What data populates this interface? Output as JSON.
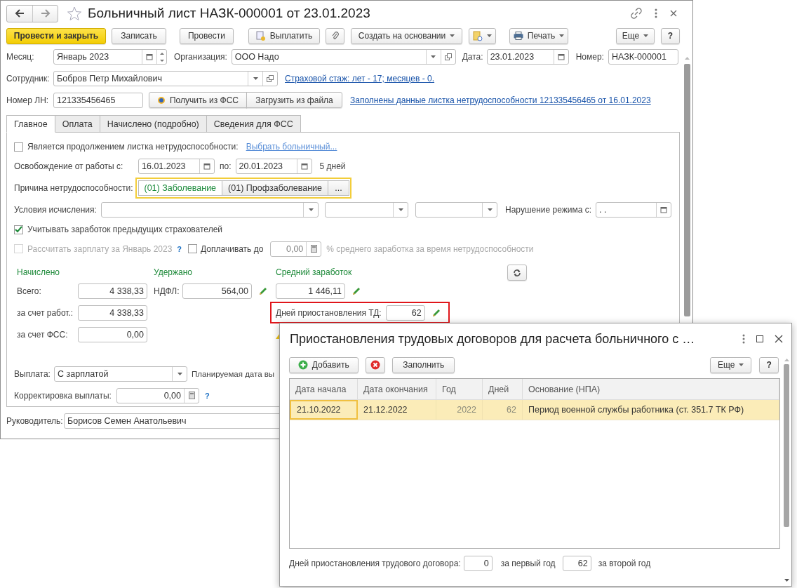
{
  "window": {
    "title": "Больничный лист НАЗК-000001 от 23.01.2023"
  },
  "toolbar": {
    "post_close": "Провести и закрыть",
    "save": "Записать",
    "post": "Провести",
    "pay": "Выплатить",
    "create_based": "Создать на основании",
    "print": "Печать",
    "more": "Еще",
    "help": "?"
  },
  "header": {
    "month": {
      "label": "Месяц:",
      "value": "Январь 2023"
    },
    "organization": {
      "label": "Организация:",
      "value": "ООО Надо"
    },
    "date": {
      "label": "Дата:",
      "value": "23.01.2023"
    },
    "number": {
      "label": "Номер:",
      "value": "НАЗК-000001"
    },
    "employee": {
      "label": "Сотрудник:",
      "value": "Бобров Петр Михайлович"
    },
    "insurance_link": "Страховой стаж: лет - 17; месяцев - 0.",
    "sick_number": {
      "label": "Номер ЛН:",
      "value": "121335456465"
    },
    "fss_buttons": [
      "Получить из ФСС",
      "Загрузить из файла"
    ],
    "filled_link": "Заполнены данные листка нетрудоспособности 121335456465 от 16.01.2023"
  },
  "tabs": [
    {
      "label": "Главное",
      "selected": true
    },
    {
      "label": "Оплата",
      "selected": false
    },
    {
      "label": "Начислено (подробно)",
      "selected": false
    },
    {
      "label": "Сведения для ФСС",
      "selected": false
    }
  ],
  "main_tab": {
    "continuation": {
      "label": "Является продолжением листка нетрудоспособности:",
      "checked": false,
      "link": "Выбрать больничный..."
    },
    "release": {
      "label": "Освобождение от работы с:",
      "from": "16.01.2023",
      "to_label": "по:",
      "to": "20.01.2023",
      "days": "5 дней"
    },
    "reason": {
      "label": "Причина нетрудоспособности:",
      "options": [
        {
          "label": "(01) Заболевание",
          "selected": true
        },
        {
          "label": "(01) Профзаболевание",
          "selected": false
        }
      ],
      "more": "..."
    },
    "conditions": {
      "label": "Условия исчисления:"
    },
    "violation": {
      "label": "Нарушение режима с:",
      "value": ". ."
    },
    "previous_employers": {
      "label": "Учитывать заработок предыдущих страхователей",
      "checked": true
    },
    "calc_salary": {
      "label": "Рассчитать зарплату за Январь 2023",
      "checked": false,
      "disabled": true,
      "help": "?"
    },
    "top_up": {
      "label": "Доплачивать до",
      "checked": false,
      "value": "0,00",
      "suffix": "% среднего заработка за время нетрудоспособности"
    },
    "accrued": {
      "heading": "Начислено",
      "rows": [
        {
          "label": "Всего:",
          "value": "4 338,33"
        },
        {
          "label": "за счет работ.:",
          "value": "4 338,33"
        },
        {
          "label": "за счет ФСС:",
          "value": "0,00"
        }
      ]
    },
    "withheld": {
      "heading": "Удержано",
      "label": "НДФЛ:",
      "value": "564,00"
    },
    "average": {
      "heading": "Средний заработок",
      "value": "1 446,11"
    },
    "suspension_days": {
      "label": "Дней приостановления ТД:",
      "value": "62",
      "highlighted": true
    },
    "payment": {
      "label": "Выплата:",
      "value": "С зарплатой",
      "planned_label": "Планируемая дата вы"
    },
    "correction": {
      "label": "Корректировка выплаты:",
      "value": "0,00",
      "help": "?"
    }
  },
  "manager": {
    "label": "Руководитель:",
    "value": "Борисов Семен Анатольевич"
  },
  "dialog": {
    "title": "Приостановления трудовых договоров для расчета больничного с …",
    "toolbar": {
      "add": "Добавить",
      "fill": "Заполнить",
      "more": "Еще",
      "help": "?"
    },
    "table": {
      "columns": [
        "Дата начала",
        "Дата окончания",
        "Год",
        "Дней",
        "Основание (НПА)"
      ],
      "rows": [
        {
          "selected": true,
          "cells": [
            "21.10.2022",
            "21.12.2022",
            "2022",
            "62",
            "Период военной службы работника (ст. 351.7 ТК РФ)"
          ]
        }
      ]
    },
    "footer": {
      "label": "Дней приостановления трудового договора:",
      "first": "0",
      "first_label": "за первый год",
      "second": "62",
      "second_label": "за второй год"
    }
  }
}
